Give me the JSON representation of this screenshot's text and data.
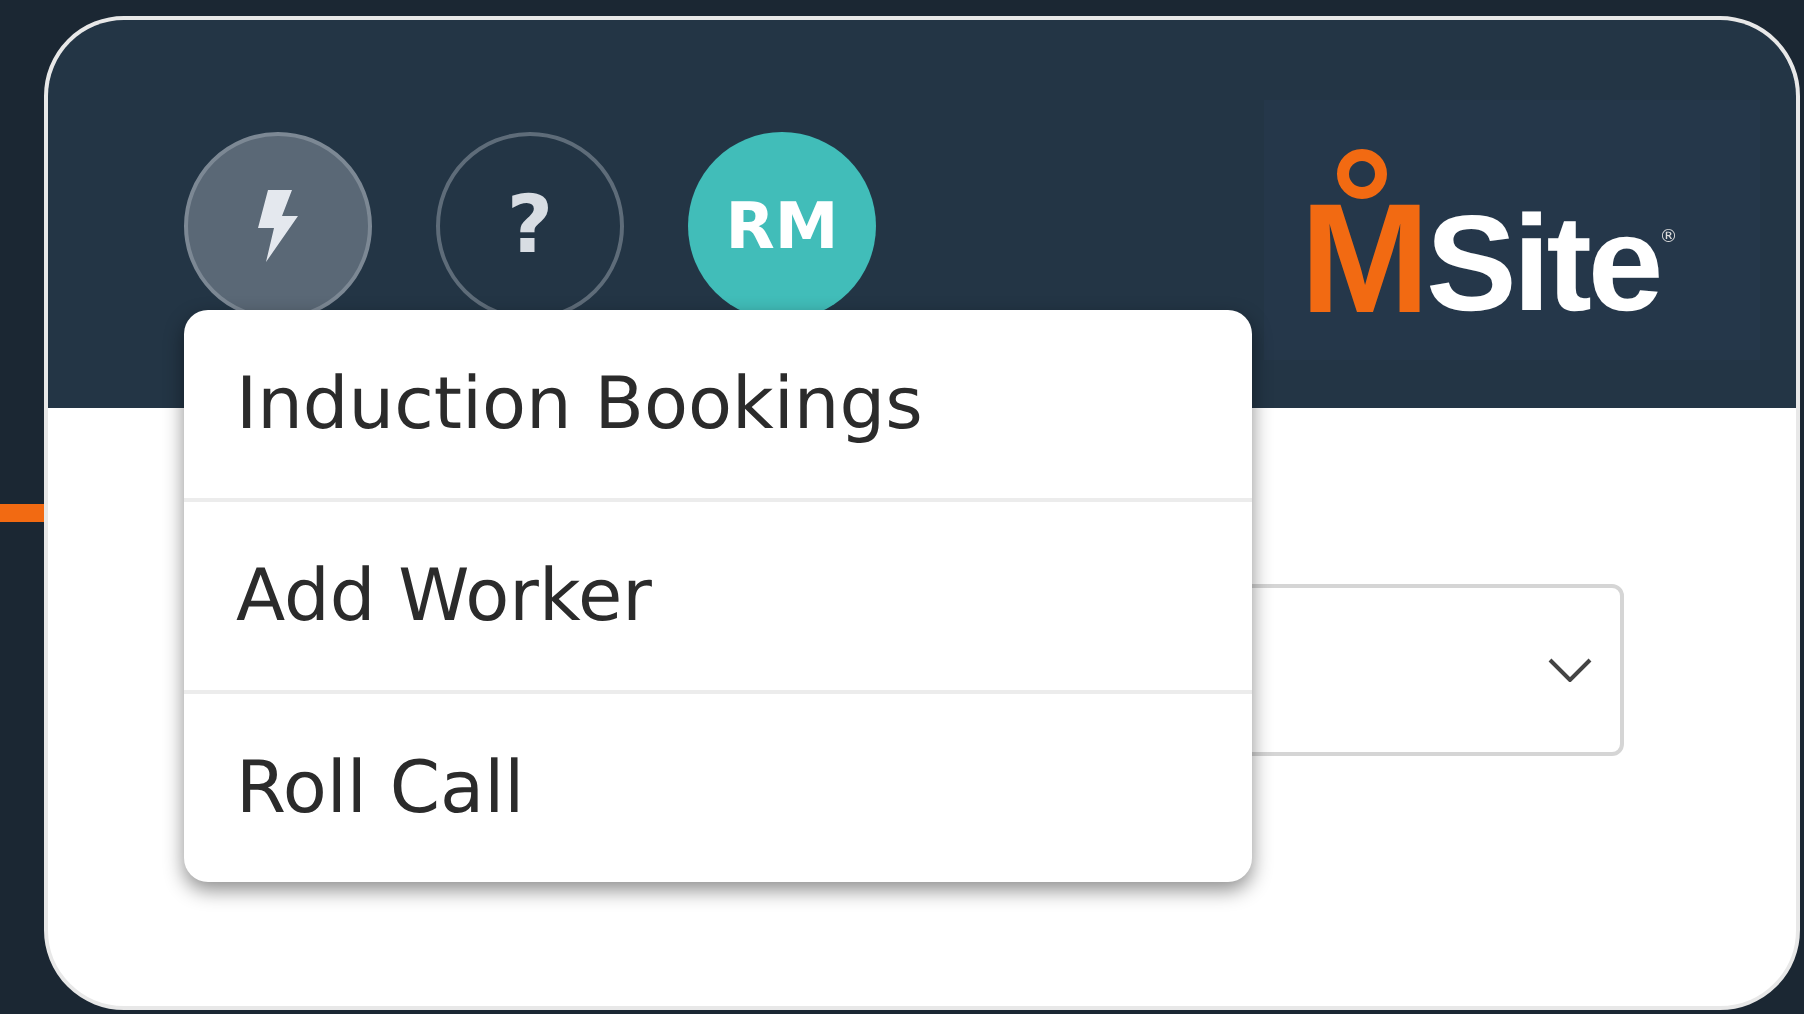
{
  "header": {
    "buttons": [
      {
        "kind": "lightning",
        "expanded": true
      },
      {
        "kind": "help",
        "label": "?",
        "expanded": false
      },
      {
        "kind": "avatar",
        "label": "RM",
        "color": "#41bdb9"
      }
    ],
    "logo": {
      "first": "M",
      "rest": "Site",
      "mark": "®"
    }
  },
  "menu": {
    "items": [
      {
        "label": "Induction Bookings"
      },
      {
        "label": "Add Worker"
      },
      {
        "label": "Roll Call"
      }
    ]
  },
  "select": {
    "kind": "dropdown"
  }
}
